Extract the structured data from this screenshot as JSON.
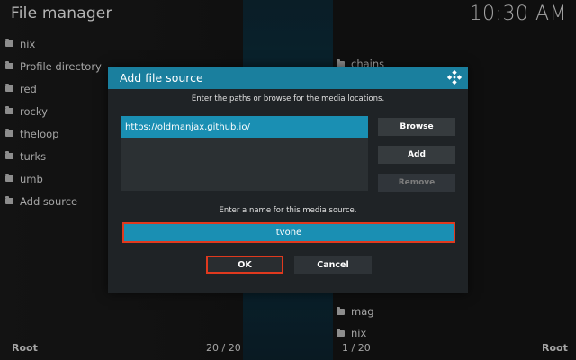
{
  "header": {
    "title": "File manager",
    "clock": "10:30 AM"
  },
  "left_pane": {
    "items": [
      {
        "label": "nix"
      },
      {
        "label": "Profile directory"
      },
      {
        "label": "red"
      },
      {
        "label": "rocky"
      },
      {
        "label": "theloop"
      },
      {
        "label": "turks"
      },
      {
        "label": "umb"
      },
      {
        "label": "Add source"
      }
    ]
  },
  "right_pane": {
    "items": [
      {
        "label": "chains"
      },
      {
        "label": "mag"
      },
      {
        "label": "nix"
      }
    ]
  },
  "footer": {
    "left_label": "Root",
    "left_count": "20 / 20",
    "right_count": "1 / 20",
    "right_label": "Root"
  },
  "dialog": {
    "title": "Add file source",
    "instructions": "Enter the paths or browse for the media locations.",
    "paths": [
      "https://oldmanjax.github.io/"
    ],
    "buttons": {
      "browse": "Browse",
      "add": "Add",
      "remove": "Remove"
    },
    "name_label": "Enter a name for this media source.",
    "name_value": "tvone",
    "ok": "OK",
    "cancel": "Cancel"
  },
  "colors": {
    "accent": "#1a8fb3",
    "header": "#1a7f9e",
    "focus_border": "#e0391e"
  }
}
